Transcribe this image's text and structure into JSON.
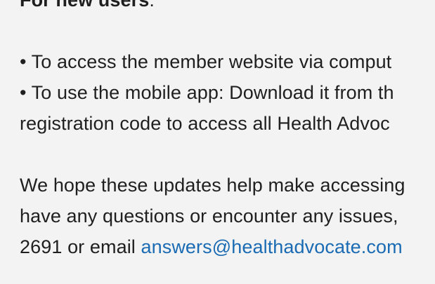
{
  "new_users": {
    "heading": "For new users",
    "heading_suffix": ":",
    "bullet_1": "• To access the member website via comput",
    "bullet_2_line_1": "• To use the mobile app: Download it from th",
    "bullet_2_line_2": "registration code to access all Health Advoc"
  },
  "closing": {
    "line_1": "We hope these updates help make accessing",
    "line_2": "have any questions or encounter any issues,",
    "line_3_prefix": "2691 or email ",
    "email_link": "answers@healthadvocate.com"
  },
  "colors": {
    "background": "#f3f3f3",
    "text": "#1f1f1f",
    "link": "#1a6bb3"
  }
}
